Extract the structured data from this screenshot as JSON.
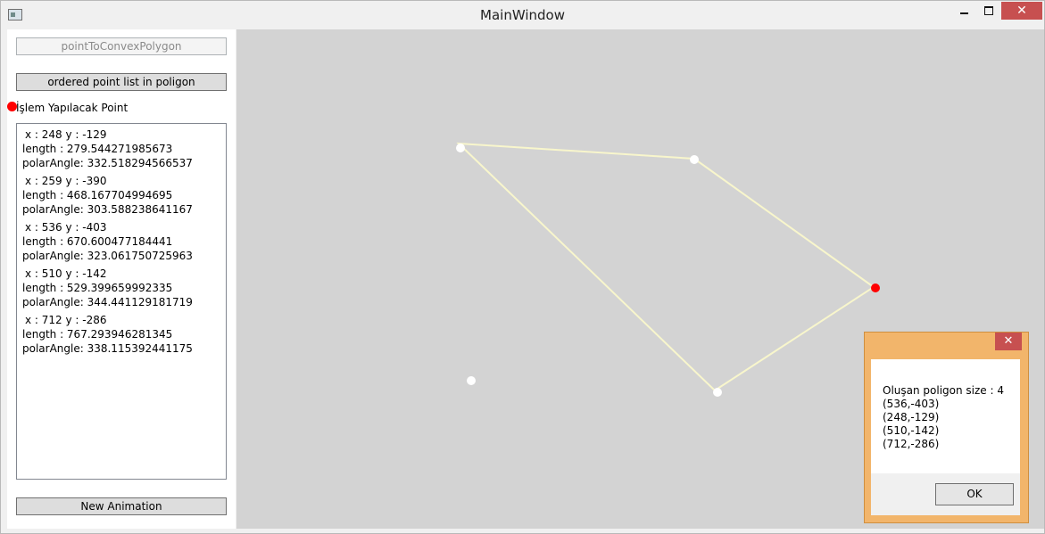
{
  "window": {
    "title": "MainWindow",
    "close_glyph": "✕"
  },
  "sidebar": {
    "convex_button": "pointToConvexPolygon",
    "ordered_button": "ordered point list in poligon",
    "point_label": "İşlem Yapılacak Point",
    "new_animation_button": "New Animation",
    "points": [
      {
        "xy": "x : 248 y : -129",
        "length": "length : 279.544271985673",
        "polar": "polarAngle: 332.518294566537"
      },
      {
        "xy": "x : 259 y : -390",
        "length": "length : 468.167704994695",
        "polar": "polarAngle: 303.588238641167"
      },
      {
        "xy": "x : 536 y : -403",
        "length": "length : 670.600477184441",
        "polar": "polarAngle: 323.061750725963"
      },
      {
        "xy": "x : 510 y : -142",
        "length": "length : 529.399659992335",
        "polar": "polarAngle: 344.441129181719"
      },
      {
        "xy": "x : 712 y : -286",
        "length": "length : 767.293946281345",
        "polar": "polarAngle: 338.115392441175"
      }
    ]
  },
  "canvas": {
    "line_color": "#f8f6cc",
    "point_color": "#ffffff",
    "active_point_color": "#ff0000",
    "background": "#d3d3d3"
  },
  "dialog": {
    "close_glyph": "✕",
    "lines": [
      "Oluşan poligon size : 4",
      "(536,-403)",
      "(248,-129)",
      "(510,-142)",
      "(712,-286)"
    ],
    "ok_label": "OK"
  }
}
